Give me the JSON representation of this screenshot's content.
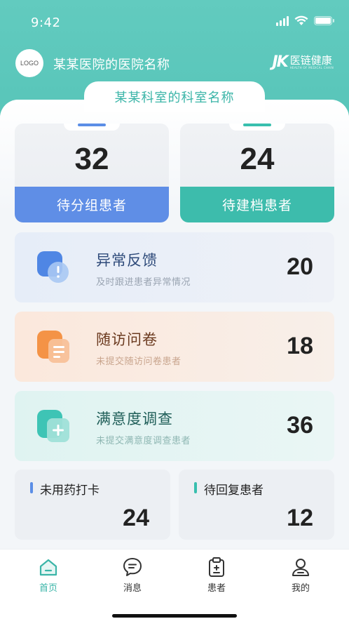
{
  "status_bar": {
    "time": "9:42"
  },
  "header": {
    "logo_text": "LOGO",
    "hospital_name": "某某医院的医院名称",
    "brand_name": "医链健康",
    "brand_sub": "HEALTH OF MEDICAL CHAIN"
  },
  "department": {
    "name": "某某科室的科室名称"
  },
  "stats": [
    {
      "value": "32",
      "label": "待分组患者",
      "accent": "#5f8ee6"
    },
    {
      "value": "24",
      "label": "待建档患者",
      "accent": "#3dbcac"
    }
  ],
  "rows": [
    {
      "title": "异常反馈",
      "subtitle": "及时跟进患者异常情况",
      "value": "20",
      "icon": "alert-icon",
      "color": "#4f86e4"
    },
    {
      "title": "随访问卷",
      "subtitle": "未提交随访问卷患者",
      "value": "18",
      "icon": "questionnaire-icon",
      "color": "#f49346"
    },
    {
      "title": "满意度调查",
      "subtitle": "未提交满意度调查患者",
      "value": "36",
      "icon": "survey-icon",
      "color": "#3ec4b5"
    }
  ],
  "small_cards": [
    {
      "title": "未用药打卡",
      "value": "24"
    },
    {
      "title": "待回复患者",
      "value": "12"
    }
  ],
  "tabs": [
    {
      "label": "首页",
      "icon": "home-icon",
      "active": true
    },
    {
      "label": "消息",
      "icon": "message-icon",
      "active": false
    },
    {
      "label": "患者",
      "icon": "patient-icon",
      "active": false
    },
    {
      "label": "我的",
      "icon": "profile-icon",
      "active": false
    }
  ]
}
